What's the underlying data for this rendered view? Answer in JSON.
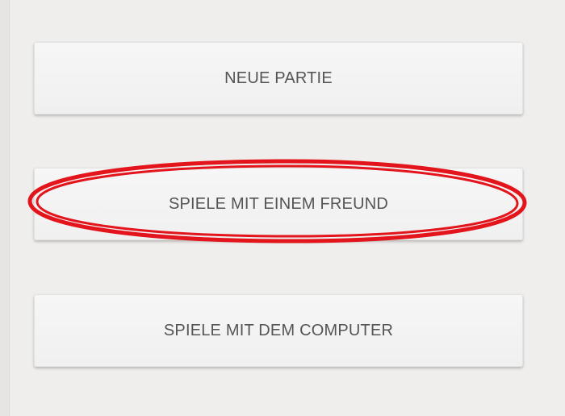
{
  "menu": {
    "buttons": [
      {
        "label": "NEUE PARTIE"
      },
      {
        "label": "SPIELE MIT EINEM FREUND"
      },
      {
        "label": "SPIELE MIT DEM COMPUTER"
      }
    ]
  },
  "annotation": {
    "highlight_color": "#e3141b",
    "highlighted_item": "SPIELE MIT EINEM FREUND"
  }
}
